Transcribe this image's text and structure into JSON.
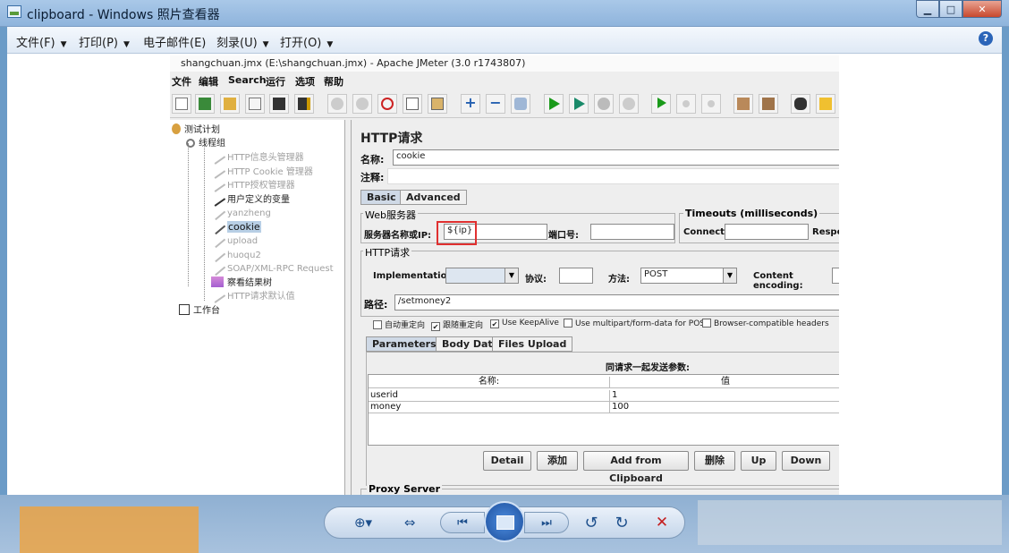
{
  "window": {
    "title": "clipboard - Windows 照片查看器",
    "min_glyph": "▁",
    "max_glyph": "□",
    "close_glyph": "✕"
  },
  "menubar": {
    "items": [
      {
        "label": "文件(F)"
      },
      {
        "label": "打印(P)"
      },
      {
        "label": "电子邮件(E)"
      },
      {
        "label": "刻录(U)"
      },
      {
        "label": "打开(O)"
      }
    ],
    "arrow": "▼",
    "help_glyph": "?"
  },
  "viewer_controls": {
    "zoom_glyph": "⊕▾",
    "fit_glyph": "⇔",
    "prev_glyph": "⏮",
    "next_glyph": "⏭",
    "rotate_ccw_glyph": "↺",
    "rotate_cw_glyph": "↻",
    "delete_glyph": "✕"
  },
  "jmeter": {
    "title": "shangchuan.jmx (E:\\shangchuan.jmx) - Apache JMeter (3.0 r1743807)",
    "menu": [
      "文件",
      "编辑",
      "Search",
      "运行",
      "选项",
      "帮助"
    ],
    "tree": {
      "items": [
        {
          "label": "测试计划"
        },
        {
          "label": "线程组"
        },
        {
          "label": "HTTP信息头管理器"
        },
        {
          "label": "HTTP Cookie 管理器"
        },
        {
          "label": "HTTP授权管理器"
        },
        {
          "label": "用户定义的变量"
        },
        {
          "label": "yanzheng"
        },
        {
          "label": "cookie"
        },
        {
          "label": "upload"
        },
        {
          "label": "huoqu2"
        },
        {
          "label": "SOAP/XML-RPC Request"
        },
        {
          "label": "察看结果树"
        },
        {
          "label": "HTTP请求默认值"
        },
        {
          "label": "工作台"
        }
      ]
    },
    "panel": {
      "title": "HTTP请求",
      "name_label": "名称:",
      "name_value": "cookie",
      "comment_label": "注释:",
      "tabs": [
        "Basic",
        "Advanced"
      ],
      "web_server": {
        "group_title": "Web服务器",
        "server_label": "服务器名称或IP:",
        "server_value": "${ip}",
        "port_label": "端口号:"
      },
      "timeouts": {
        "group_title": "Timeouts (milliseconds)",
        "connect_label": "Connect:",
        "response_label": "Respo"
      },
      "http_request": {
        "group_title": "HTTP请求",
        "implementation_label": "Implementation:",
        "protocol_label": "协议:",
        "method_label": "方法:",
        "method_value": "POST",
        "encoding_label": "Content encoding:",
        "path_label": "路径:",
        "path_value": "/setmoney2"
      },
      "checkboxes": [
        {
          "label": "自动重定向",
          "checked": false
        },
        {
          "label": "跟随重定向",
          "checked": true
        },
        {
          "label": "Use KeepAlive",
          "checked": true
        },
        {
          "label": "Use multipart/form-data for POST",
          "checked": false
        },
        {
          "label": "Browser-compatible headers",
          "checked": false
        }
      ],
      "sub_tabs": [
        "Parameters",
        "Body Data",
        "Files Upload"
      ],
      "params_caption": "同请求一起发送参数:",
      "params_columns": [
        "名称:",
        "值"
      ],
      "params_rows": [
        {
          "name": "userid",
          "value": "1"
        },
        {
          "name": "money",
          "value": "100"
        }
      ],
      "buttons": [
        "Detail",
        "添加",
        "Add from Clipboard",
        "删除",
        "Up",
        "Down"
      ],
      "proxy_title": "Proxy Server"
    }
  }
}
